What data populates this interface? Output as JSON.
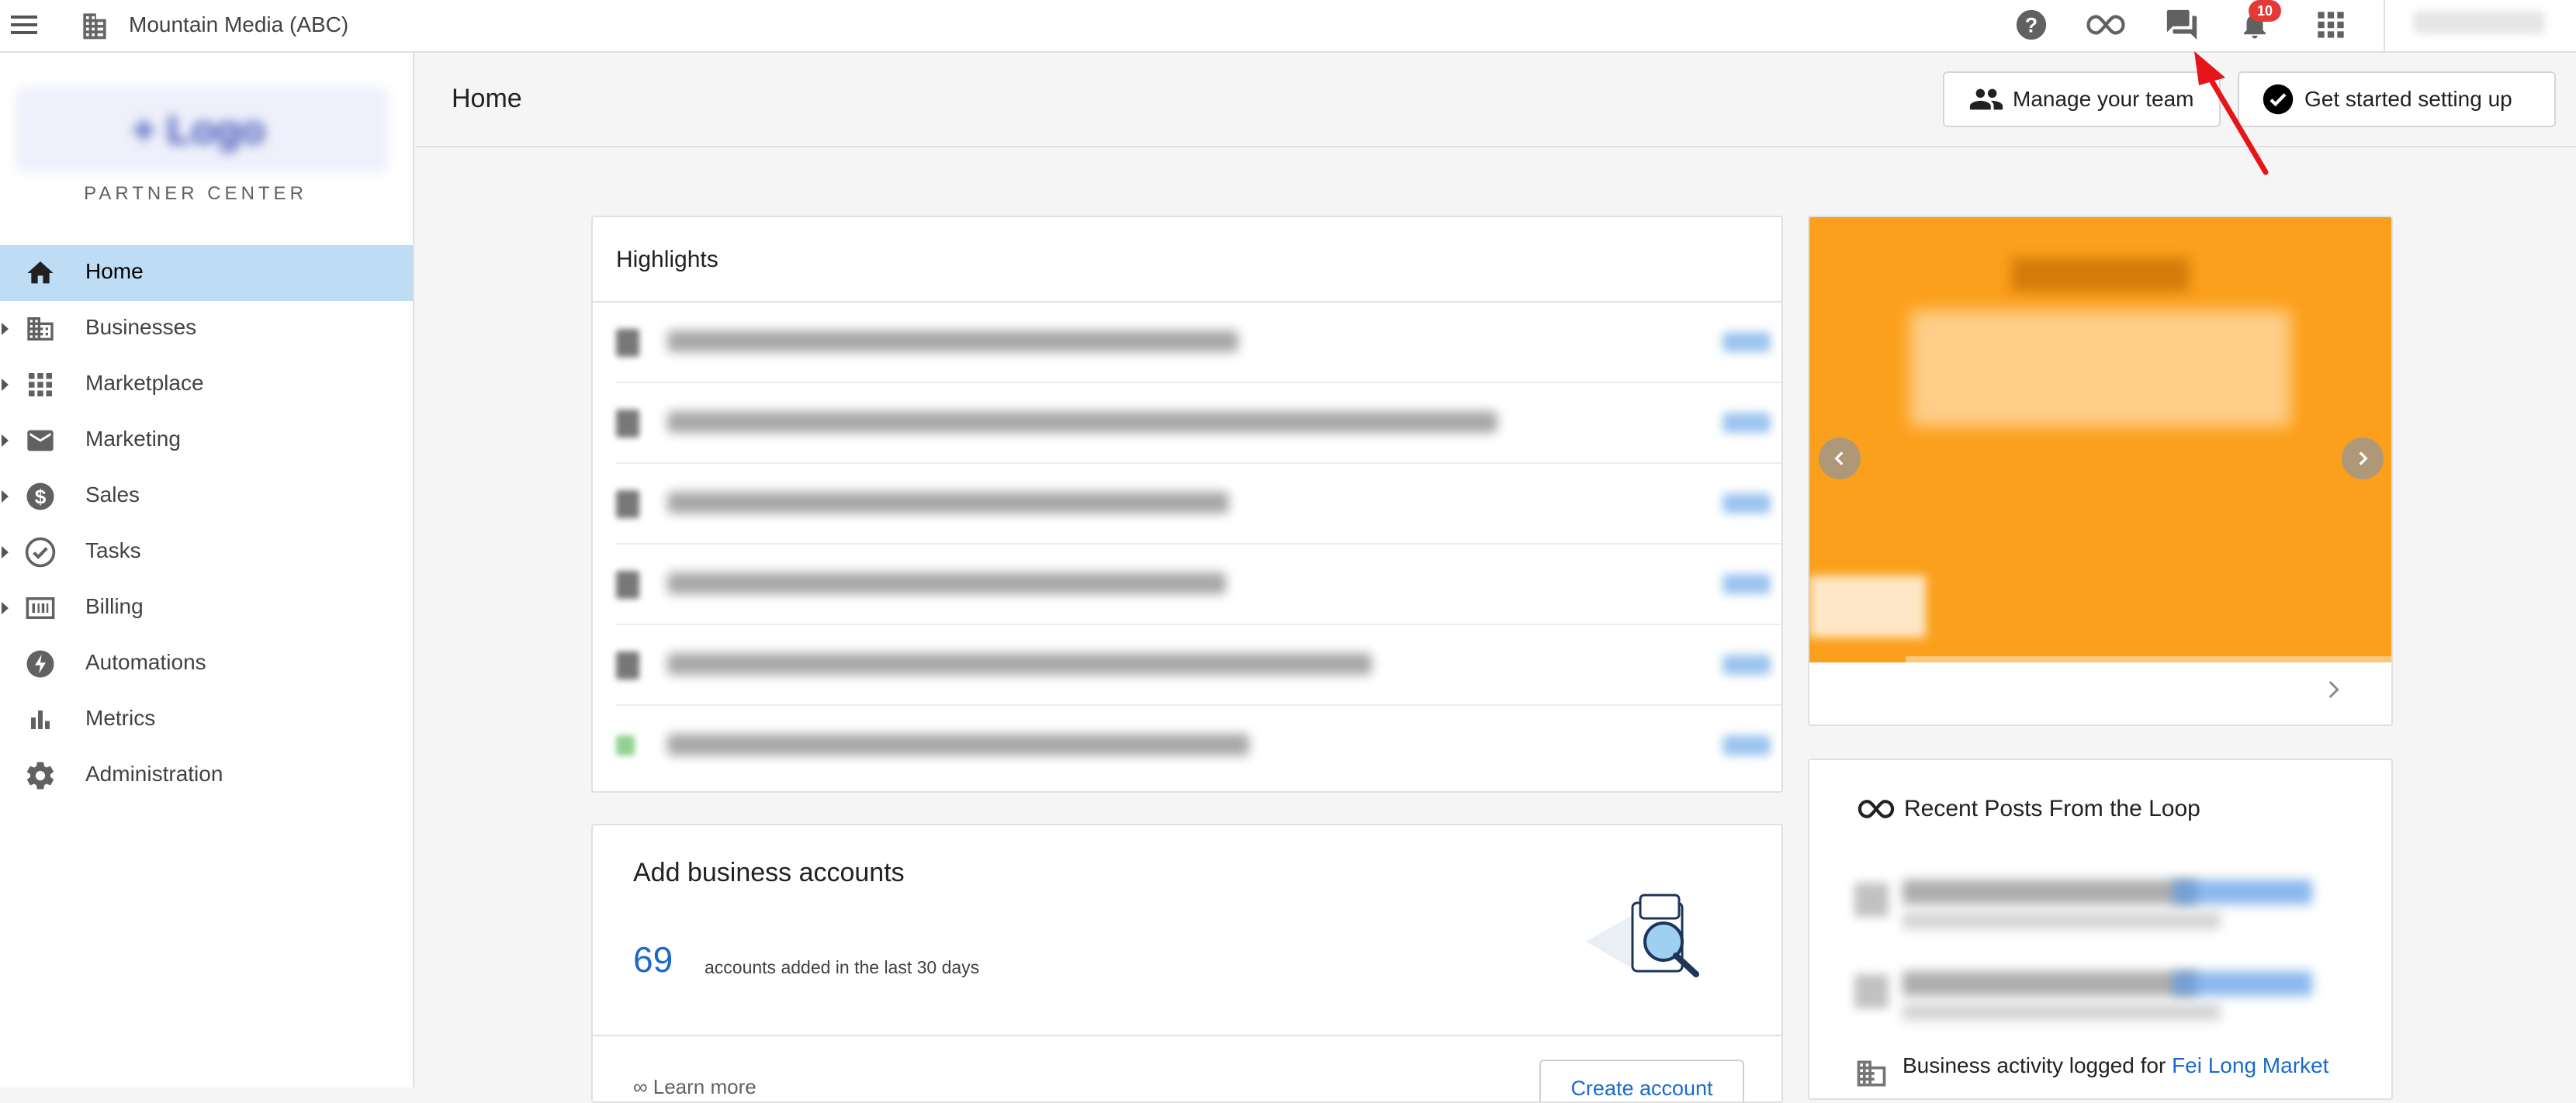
{
  "topbar": {
    "account_name": "Mountain Media (ABC)",
    "notification_count": "10",
    "icons": [
      "menu-icon",
      "building-icon",
      "help-icon",
      "infinity-icon",
      "chat-icon",
      "bell-icon",
      "apps-grid-icon"
    ]
  },
  "sidebar": {
    "logo_text": "+ Logo",
    "subtitle": "PARTNER CENTER",
    "items": [
      {
        "label": "Home",
        "icon": "home-icon"
      },
      {
        "label": "Businesses",
        "icon": "building-icon"
      },
      {
        "label": "Marketplace",
        "icon": "apps-grid-icon"
      },
      {
        "label": "Marketing",
        "icon": "mail-icon"
      },
      {
        "label": "Sales",
        "icon": "dollar-icon"
      },
      {
        "label": "Tasks",
        "icon": "check-circle-icon"
      },
      {
        "label": "Billing",
        "icon": "billing-icon"
      },
      {
        "label": "Automations",
        "icon": "bolt-icon"
      },
      {
        "label": "Metrics",
        "icon": "bar-chart-icon"
      },
      {
        "label": "Administration",
        "icon": "gear-icon"
      }
    ]
  },
  "header": {
    "title": "Home",
    "manage_team_label": "Manage your team",
    "get_started_label": "Get started setting up"
  },
  "highlights": {
    "title": "Highlights",
    "view_label": "View"
  },
  "accounts": {
    "title": "Add business accounts",
    "count": "69",
    "count_caption": "accounts added in the last 30 days",
    "learn_more": "Learn more",
    "create_label": "Create account"
  },
  "loop": {
    "title": "Recent Posts From the Loop",
    "last_post_text": "Business activity logged for ",
    "last_post_link": "Fei Long Market"
  },
  "colors": {
    "active_nav": "#bfdcf5",
    "promo": "#fba01c",
    "link": "#1a6ac9",
    "annotation_arrow": "#e5161b"
  }
}
